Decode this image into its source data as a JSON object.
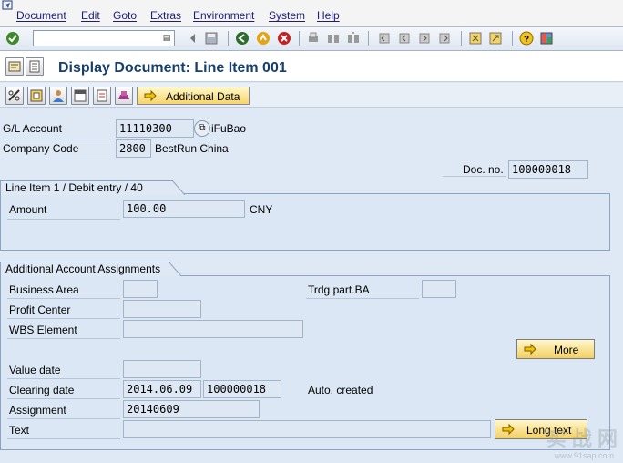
{
  "menu": [
    "Document",
    "Edit",
    "Goto",
    "Extras",
    "Environment",
    "System",
    "Help"
  ],
  "command_field": {
    "value": ""
  },
  "title": "Display Document: Line Item 001",
  "app_toolbar": {
    "additional_data_label": "Additional Data"
  },
  "header": {
    "gl_account_label": "G/L Account",
    "gl_account_value": "11110300",
    "gl_account_text": "iFuBao",
    "company_code_label": "Company Code",
    "company_code_value": "2800",
    "company_code_text": "BestRun China",
    "doc_no_label": "Doc. no.",
    "doc_no_value": "100000018"
  },
  "line_item_group": {
    "title": "Line Item 1 / Debit entry / 40",
    "amount_label": "Amount",
    "amount_value": "100.00",
    "currency": "CNY"
  },
  "assign_group": {
    "title": "Additional Account Assignments",
    "business_area_label": "Business Area",
    "business_area_value": "",
    "trdg_part_label": "Trdg part.BA",
    "trdg_part_value": "",
    "profit_center_label": "Profit Center",
    "profit_center_value": "",
    "wbs_label": "WBS Element",
    "wbs_value": "",
    "more_label": "More",
    "value_date_label": "Value date",
    "value_date_value": "",
    "clearing_date_label": "Clearing date",
    "clearing_date_value": "2014.06.09",
    "clearing_doc_value": "100000018",
    "auto_created_text": "Auto. created",
    "assignment_label": "Assignment",
    "assignment_value": "20140609",
    "text_label": "Text",
    "text_value": "",
    "long_text_label": "Long text"
  },
  "watermark": {
    "text": "实 战 网",
    "url": "www.91sap.com"
  },
  "colors": {
    "title": "#173f6d",
    "menu_text": "#1c1c7a",
    "background": "#dfe9f5",
    "button_gradient_top": "#fff8c8",
    "button_gradient_bottom": "#f6d46b"
  }
}
